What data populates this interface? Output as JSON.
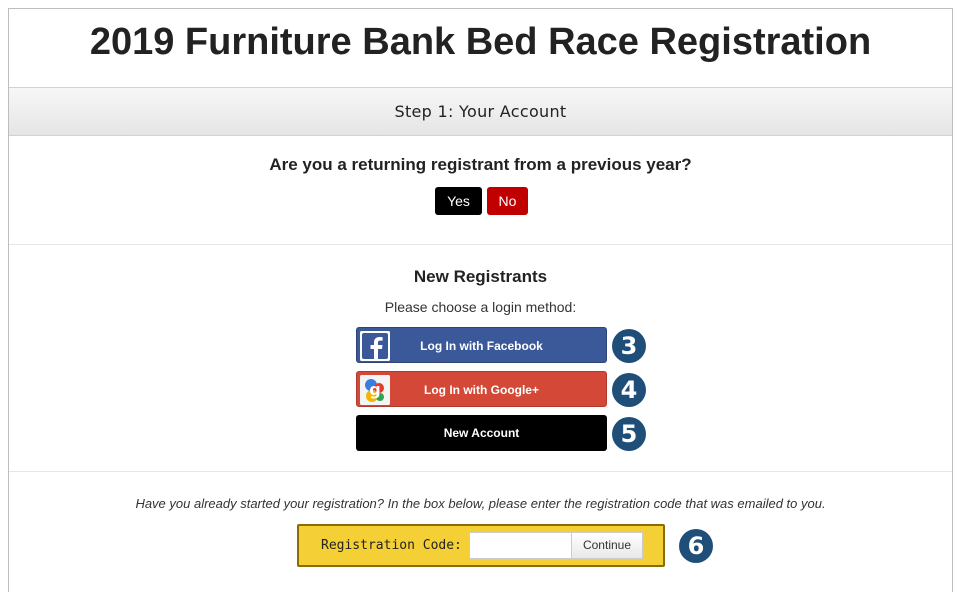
{
  "page": {
    "title": "2019 Furniture Bank Bed Race Registration"
  },
  "step": {
    "label": "Step 1: Your Account"
  },
  "returning": {
    "question": "Are you a returning registrant from a previous year?",
    "yes_label": "Yes",
    "no_label": "No"
  },
  "new_registrants": {
    "heading": "New Registrants",
    "subtext": "Please choose a login method:",
    "facebook_label": "Log In with Facebook",
    "google_label": "Log In with Google+",
    "new_account_label": "New Account"
  },
  "callouts": {
    "facebook": "3",
    "google": "4",
    "new_account": "5",
    "registration_code": "6"
  },
  "registration": {
    "prompt": "Have you already started your registration? In the box below, please enter the registration code that was emailed to you.",
    "code_label": "Registration Code:",
    "code_value": "",
    "continue_label": "Continue"
  },
  "colors": {
    "facebook": "#3b5998",
    "google": "#d34836",
    "no_button": "#c00000",
    "callout": "#1f4e79",
    "code_box": "#f5cf36"
  }
}
